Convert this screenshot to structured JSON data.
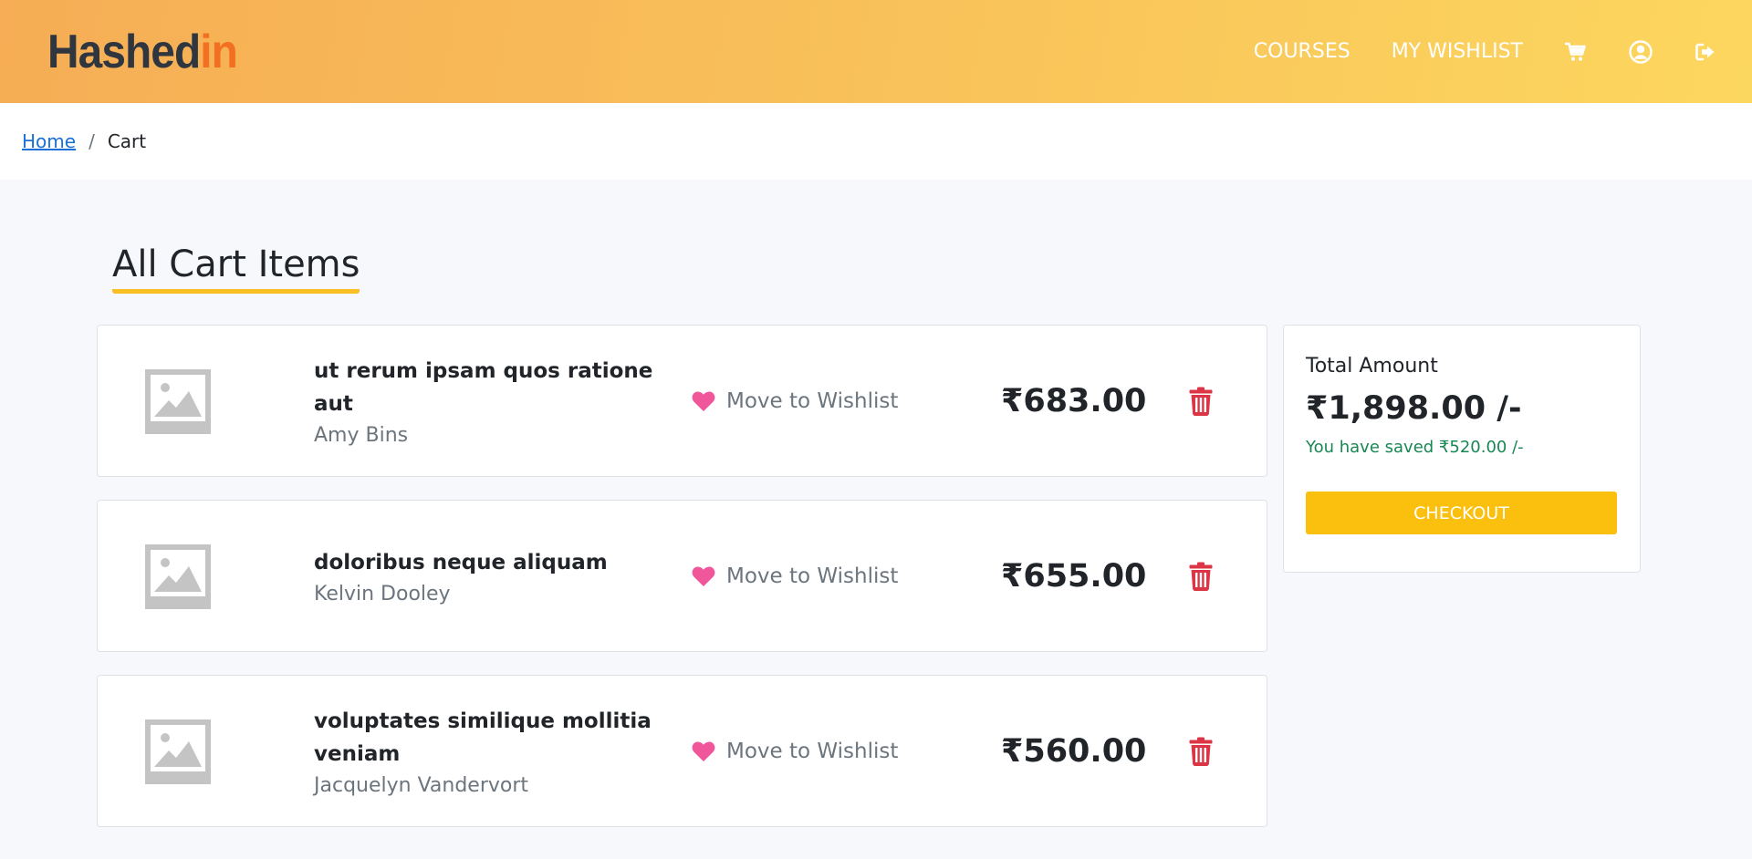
{
  "brand": {
    "part1": "Hashed",
    "part2": "in"
  },
  "nav": {
    "courses": "COURSES",
    "wishlist": "MY WISHLIST",
    "cart_icon": "cart-icon",
    "profile_icon": "user-circle-icon",
    "logout_icon": "sign-out-icon"
  },
  "breadcrumb": {
    "home": "Home",
    "separator": "/",
    "current": "Cart"
  },
  "page": {
    "title": "All Cart Items"
  },
  "cart": {
    "items": [
      {
        "title": "ut rerum ipsam quos ratione aut",
        "author": "Amy Bins",
        "wishlist_label": "Move to Wishlist",
        "price": "₹683.00"
      },
      {
        "title": "doloribus neque aliquam",
        "author": "Kelvin Dooley",
        "wishlist_label": "Move to Wishlist",
        "price": "₹655.00"
      },
      {
        "title": "voluptates similique mollitia veniam",
        "author": "Jacquelyn Vandervort",
        "wishlist_label": "Move to Wishlist",
        "price": "₹560.00"
      }
    ]
  },
  "summary": {
    "label": "Total Amount",
    "total": "₹1,898.00 /-",
    "saved": "You have saved ₹520.00 /-",
    "checkout": "CHECKOUT"
  },
  "colors": {
    "header_start": "#f6ad55",
    "header_end": "#fcd75e",
    "accent": "#fbbf24",
    "heart": "#f0569a",
    "delete": "#dc3545",
    "saved": "#198754",
    "link": "#1a6fd8"
  }
}
